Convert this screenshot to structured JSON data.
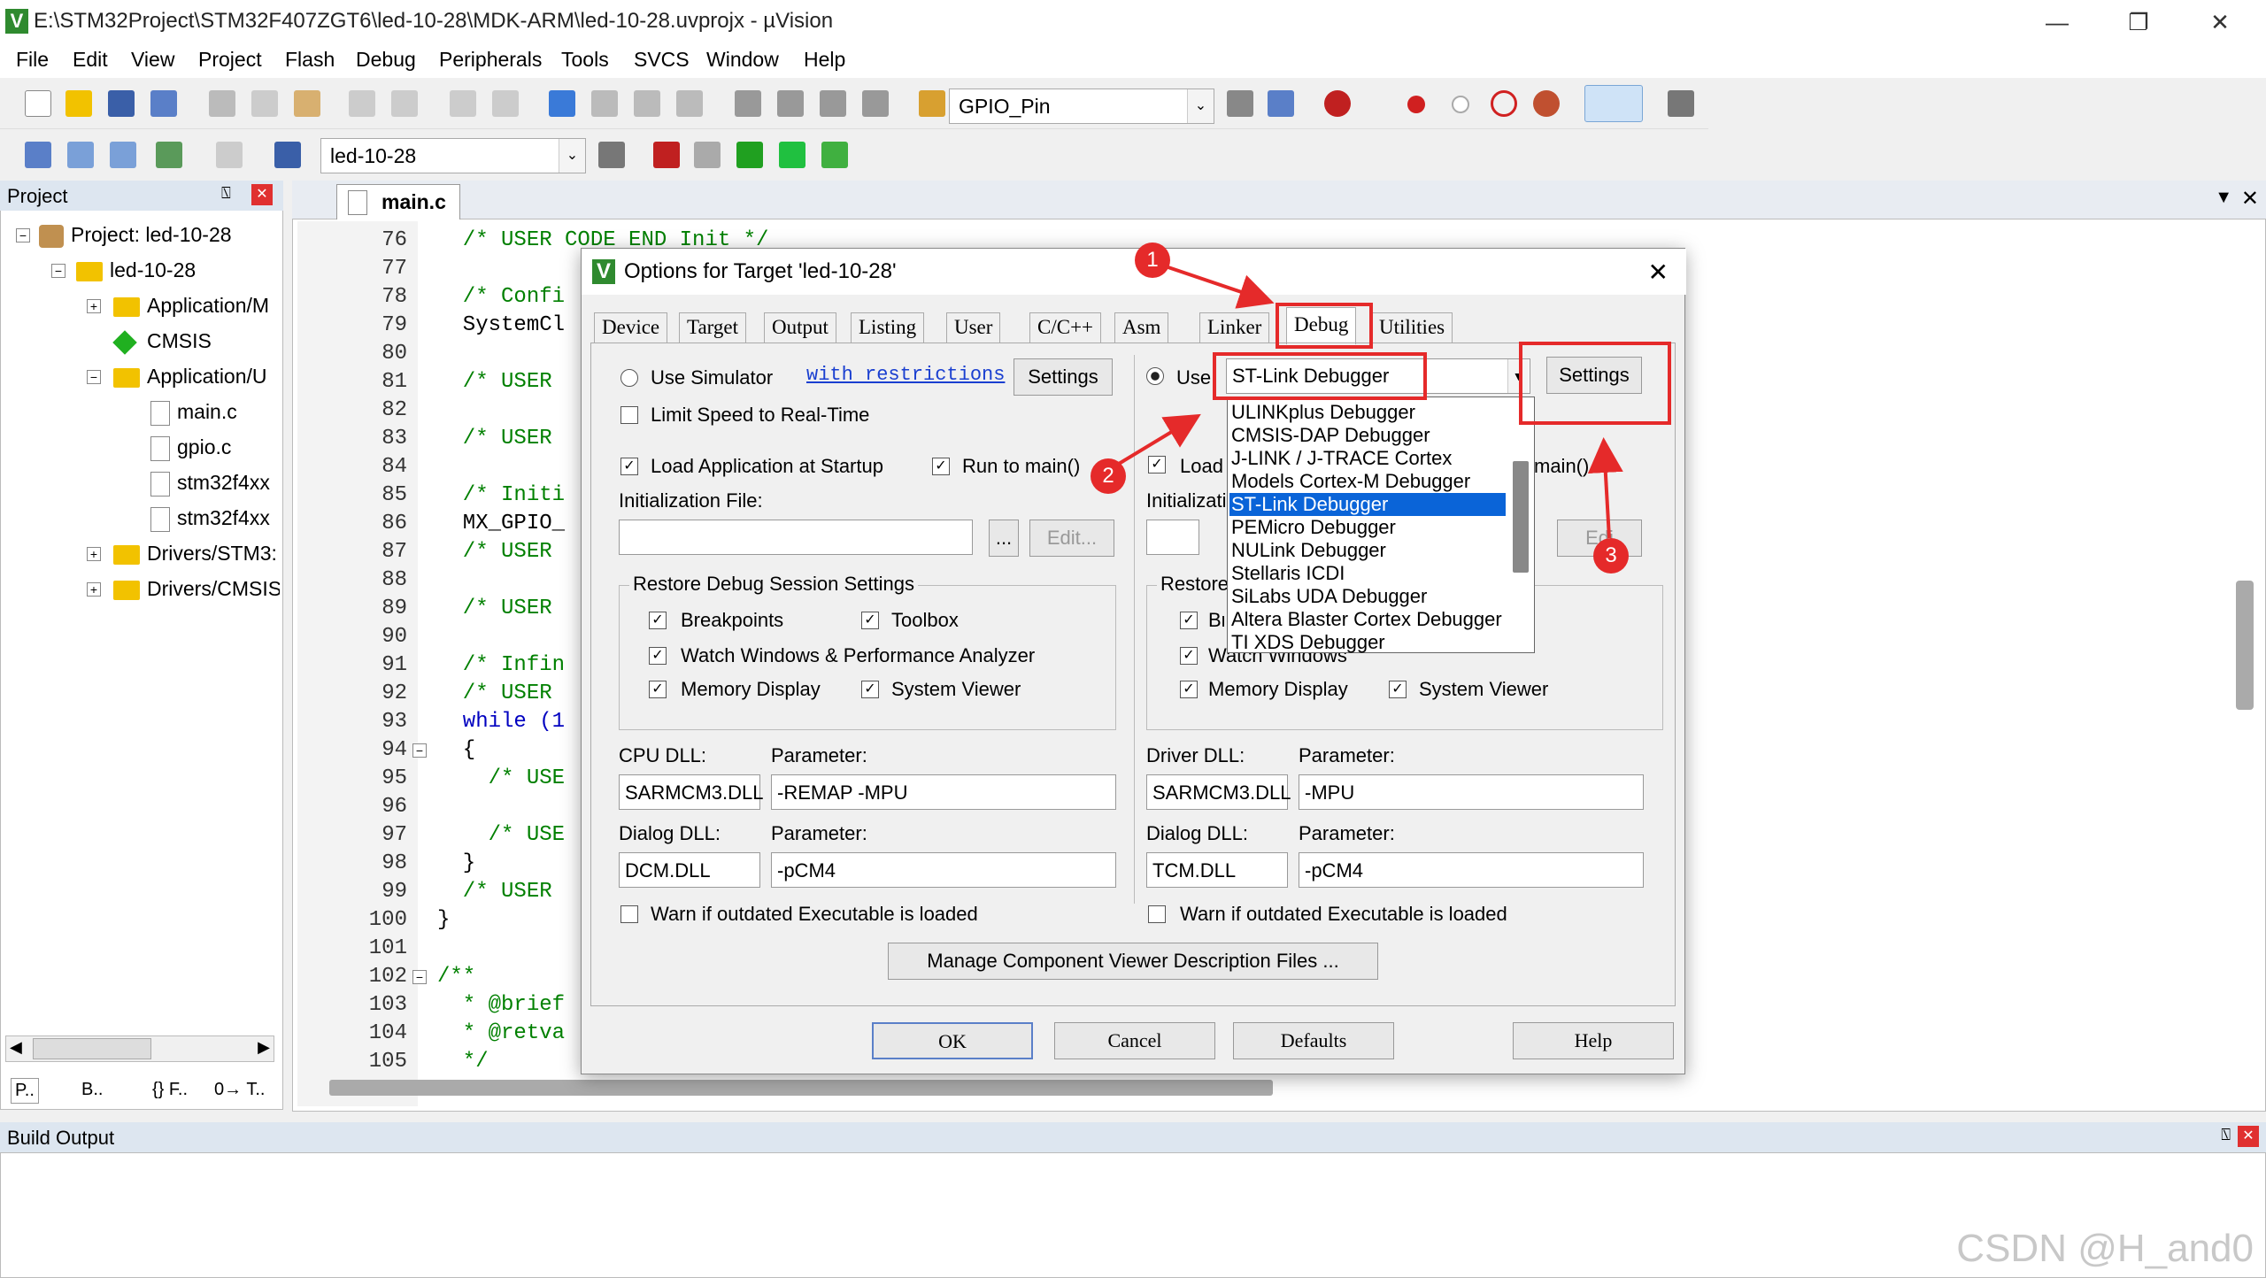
{
  "window": {
    "title": "E:\\STM32Project\\STM32F407ZGT6\\led-10-28\\MDK-ARM\\led-10-28.uvprojx - µVision"
  },
  "menu": [
    "File",
    "Edit",
    "View",
    "Project",
    "Flash",
    "Debug",
    "Peripherals",
    "Tools",
    "SVCS",
    "Window",
    "Help"
  ],
  "toolbar": {
    "find_combo": "GPIO_Pin",
    "target_combo": "led-10-28"
  },
  "project": {
    "header": "Project",
    "root": "Project: led-10-28",
    "target": "led-10-28",
    "items": [
      "Application/M",
      "CMSIS",
      "Application/U",
      "main.c",
      "gpio.c",
      "stm32f4xx",
      "stm32f4xx",
      "Drivers/STM3:",
      "Drivers/CMSIS"
    ],
    "bottom_tabs": [
      "P..",
      "B..",
      "{} F..",
      "0→ T.."
    ]
  },
  "editor": {
    "tab": "main.c",
    "lines": [
      {
        "n": "76",
        "t": "  /* USER CODE END Init */"
      },
      {
        "n": "77",
        "t": ""
      },
      {
        "n": "78",
        "t": "  /* Confi"
      },
      {
        "n": "79",
        "t": "  SystemCl"
      },
      {
        "n": "80",
        "t": ""
      },
      {
        "n": "81",
        "t": "  /* USER"
      },
      {
        "n": "82",
        "t": ""
      },
      {
        "n": "83",
        "t": "  /* USER"
      },
      {
        "n": "84",
        "t": ""
      },
      {
        "n": "85",
        "t": "  /* Initi"
      },
      {
        "n": "86",
        "t": "  MX_GPIO_"
      },
      {
        "n": "87",
        "t": "  /* USER"
      },
      {
        "n": "88",
        "t": ""
      },
      {
        "n": "89",
        "t": "  /* USER"
      },
      {
        "n": "90",
        "t": ""
      },
      {
        "n": "91",
        "t": "  /* Infin"
      },
      {
        "n": "92",
        "t": "  /* USER"
      },
      {
        "n": "93",
        "t": "  while (1"
      },
      {
        "n": "94",
        "t": "  {"
      },
      {
        "n": "95",
        "t": "    /* USE"
      },
      {
        "n": "96",
        "t": ""
      },
      {
        "n": "97",
        "t": "    /* USE"
      },
      {
        "n": "98",
        "t": "  }"
      },
      {
        "n": "99",
        "t": "  /* USER"
      },
      {
        "n": "100",
        "t": "}"
      },
      {
        "n": "101",
        "t": ""
      },
      {
        "n": "102",
        "t": "/**"
      },
      {
        "n": "103",
        "t": "  * @brief"
      },
      {
        "n": "104",
        "t": "  * @retva"
      },
      {
        "n": "105",
        "t": "  */"
      }
    ]
  },
  "dialog": {
    "title": "Options for Target 'led-10-28'",
    "tabs": [
      "Device",
      "Target",
      "Output",
      "Listing",
      "User",
      "C/C++",
      "Asm",
      "Linker",
      "Debug",
      "Utilities"
    ],
    "left": {
      "use_simulator": "Use Simulator",
      "with_restrictions": "with restrictions",
      "settings": "Settings",
      "limit_speed": "Limit Speed to Real-Time",
      "load_app": "Load Application at Startup",
      "run_to_main": "Run to main()",
      "init_file": "Initialization File:",
      "browse": "...",
      "edit": "Edit...",
      "restore_group": "Restore Debug Session Settings",
      "breakpoints": "Breakpoints",
      "toolbox": "Toolbox",
      "watch_perf": "Watch Windows & Performance Analyzer",
      "memory_display": "Memory Display",
      "system_viewer": "System Viewer",
      "cpu_dll_label": "CPU DLL:",
      "param_label": "Parameter:",
      "cpu_dll": "SARMCM3.DLL",
      "cpu_param": "-REMAP -MPU",
      "dialog_dll_label": "Dialog DLL:",
      "dialog_dll": "DCM.DLL",
      "dialog_param": "-pCM4",
      "warn": "Warn if outdated Executable is loaded"
    },
    "right": {
      "use": "Use:",
      "debugger": "ST-Link Debugger",
      "settings": "Settings",
      "load": "Load",
      "run_to_main": "main()",
      "init_file": "Initializatio",
      "edit": "Edi",
      "restore": "Restore",
      "bre": "Bre",
      "watch": "Watch Windows",
      "memory_display": "Memory Display",
      "system_viewer": "System Viewer",
      "driver_dll_label": "Driver DLL:",
      "param_label": "Parameter:",
      "driver_dll": "SARMCM3.DLL",
      "driver_param": "-MPU",
      "dialog_dll_label": "Dialog DLL:",
      "dialog_dll": "TCM.DLL",
      "dialog_param": "-pCM4",
      "warn": "Warn if outdated Executable is loaded"
    },
    "dropdown": [
      "ULINKplus Debugger",
      "CMSIS-DAP Debugger",
      "J-LINK / J-TRACE Cortex",
      "Models Cortex-M Debugger",
      "ST-Link Debugger",
      "PEMicro Debugger",
      "NULink Debugger",
      "Stellaris ICDI",
      "SiLabs UDA Debugger",
      "Altera Blaster Cortex Debugger",
      "TI XDS Debugger"
    ],
    "manage_btn": "Manage Component Viewer Description Files ...",
    "buttons": {
      "ok": "OK",
      "cancel": "Cancel",
      "defaults": "Defaults",
      "help": "Help"
    }
  },
  "annotations": [
    "1",
    "2",
    "3"
  ],
  "build": {
    "header": "Build Output"
  },
  "watermark": "CSDN @H_and0"
}
